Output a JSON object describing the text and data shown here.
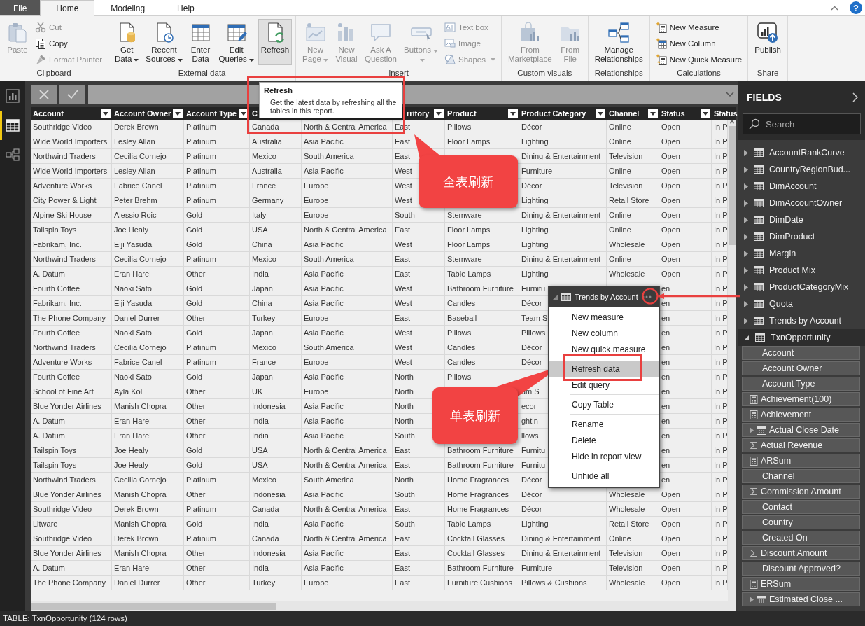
{
  "ribbon": {
    "tabs": [
      {
        "label": "File",
        "kind": "file",
        "selected": false
      },
      {
        "label": "Home",
        "kind": "tab",
        "selected": true
      },
      {
        "label": "Modeling",
        "kind": "tab",
        "selected": false
      },
      {
        "label": "Help",
        "kind": "tab",
        "selected": false
      }
    ],
    "help_button": "?",
    "groups": [
      {
        "title": "Clipboard",
        "items": [
          {
            "kind": "large",
            "lines": [
              "Paste"
            ],
            "disabled": true,
            "dropdown": false,
            "highlighted": false
          },
          {
            "kind": "small",
            "lines": [
              "Cut"
            ],
            "disabled": true,
            "dropdown": false,
            "highlighted": false
          },
          {
            "kind": "small",
            "lines": [
              "Copy"
            ],
            "disabled": false,
            "dropdown": false,
            "highlighted": false
          },
          {
            "kind": "small",
            "lines": [
              "Format Painter"
            ],
            "disabled": true,
            "dropdown": false,
            "highlighted": false
          }
        ]
      },
      {
        "title": "External data",
        "items": [
          {
            "kind": "large",
            "lines": [
              "Get",
              "Data"
            ],
            "disabled": false,
            "dropdown": true,
            "highlighted": false
          },
          {
            "kind": "large",
            "lines": [
              "Recent",
              "Sources"
            ],
            "disabled": false,
            "dropdown": true,
            "highlighted": false
          },
          {
            "kind": "large",
            "lines": [
              "Enter",
              "Data"
            ],
            "disabled": false,
            "dropdown": false,
            "highlighted": false
          },
          {
            "kind": "large",
            "lines": [
              "Edit",
              "Queries"
            ],
            "disabled": false,
            "dropdown": true,
            "highlighted": false
          },
          {
            "kind": "large",
            "lines": [
              "Refresh"
            ],
            "disabled": false,
            "dropdown": false,
            "highlighted": true
          }
        ]
      },
      {
        "title": "Insert",
        "items": [
          {
            "kind": "large",
            "lines": [
              "New",
              "Page"
            ],
            "disabled": true,
            "dropdown": true,
            "highlighted": false
          },
          {
            "kind": "large",
            "lines": [
              "New",
              "Visual"
            ],
            "disabled": true,
            "dropdown": false,
            "highlighted": false
          },
          {
            "kind": "large",
            "lines": [
              "Ask A",
              "Question"
            ],
            "disabled": true,
            "dropdown": false,
            "highlighted": false
          },
          {
            "kind": "large",
            "lines": [
              "Buttons"
            ],
            "disabled": true,
            "dropdown": true,
            "highlighted": false
          },
          {
            "kind": "small",
            "lines": [
              "Text box"
            ],
            "disabled": true,
            "dropdown": false,
            "highlighted": false
          },
          {
            "kind": "small",
            "lines": [
              "Image"
            ],
            "disabled": true,
            "dropdown": false,
            "highlighted": false
          },
          {
            "kind": "small",
            "lines": [
              "Shapes"
            ],
            "disabled": true,
            "dropdown": true,
            "highlighted": false
          }
        ]
      },
      {
        "title": "Custom visuals",
        "items": [
          {
            "kind": "large",
            "lines": [
              "From",
              "Marketplace"
            ],
            "disabled": true,
            "dropdown": false,
            "highlighted": false
          },
          {
            "kind": "large",
            "lines": [
              "From",
              "File"
            ],
            "disabled": true,
            "dropdown": false,
            "highlighted": false
          }
        ]
      },
      {
        "title": "Relationships",
        "items": [
          {
            "kind": "large",
            "lines": [
              "Manage",
              "Relationships"
            ],
            "disabled": false,
            "dropdown": false,
            "highlighted": false
          }
        ]
      },
      {
        "title": "Calculations",
        "items": [
          {
            "kind": "small",
            "lines": [
              "New Measure"
            ],
            "disabled": false,
            "dropdown": false,
            "highlighted": false
          },
          {
            "kind": "small",
            "lines": [
              "New Column"
            ],
            "disabled": false,
            "dropdown": false,
            "highlighted": false
          },
          {
            "kind": "small",
            "lines": [
              "New Quick Measure"
            ],
            "disabled": false,
            "dropdown": false,
            "highlighted": false
          }
        ]
      },
      {
        "title": "Share",
        "items": [
          {
            "kind": "large",
            "lines": [
              "Publish"
            ],
            "disabled": false,
            "dropdown": false,
            "highlighted": false
          }
        ]
      }
    ]
  },
  "nav": [
    {
      "selected": false
    },
    {
      "selected": true
    },
    {
      "selected": false
    }
  ],
  "table": {
    "columns": [
      {
        "label": "Account",
        "filter": true
      },
      {
        "label": "Account Owner",
        "filter": true
      },
      {
        "label": "Account Type",
        "filter": true
      },
      {
        "label": "C"
      },
      {},
      {
        "label": "rritory",
        "filter": true
      },
      {
        "label": "Product",
        "filter": true
      },
      {
        "label": "Product Category",
        "filter": true
      },
      {
        "label": "Channel",
        "filter": true
      },
      {
        "label": "Status",
        "filter": true
      },
      {
        "label": "Status"
      }
    ],
    "rows": [
      [
        "Southridge Video",
        "Derek Brown",
        "Platinum",
        "Canada",
        "North & Central America",
        "East",
        "Pillows",
        "Décor",
        "Online",
        "Open",
        "In P"
      ],
      [
        "Wide World Importers",
        "Lesley Allan",
        "Platinum",
        "Australia",
        "Asia Pacific",
        "East",
        "Floor Lamps",
        "Lighting",
        "Online",
        "Open",
        "In P"
      ],
      [
        "Northwind Traders",
        "Cecilia Cornejo",
        "Platinum",
        "Mexico",
        "South America",
        "East",
        null,
        "Dining & Entertainment",
        "Television",
        "Open",
        "In P"
      ],
      [
        "Wide World Importers",
        "Lesley Allan",
        "Platinum",
        "Australia",
        "Asia Pacific",
        "West",
        null,
        "Furniture",
        "Online",
        "Open",
        "In P"
      ],
      [
        "Adventure Works",
        "Fabrice Canel",
        "Platinum",
        "France",
        "Europe",
        "West",
        null,
        "Décor",
        "Television",
        "Open",
        "In P"
      ],
      [
        "City Power & Light",
        "Peter Brehm",
        "Platinum",
        "Germany",
        "Europe",
        "West",
        null,
        "Lighting",
        "Retail Store",
        "Open",
        "In P"
      ],
      [
        "Alpine Ski House",
        "Alessio Roic",
        "Gold",
        "Italy",
        "Europe",
        "South",
        "Stemware",
        "Dining & Entertainment",
        "Online",
        "Open",
        "In P"
      ],
      [
        "Tailspin Toys",
        "Joe Healy",
        "Gold",
        "USA",
        "North & Central America",
        "East",
        "Floor Lamps",
        "Lighting",
        "Online",
        "Open",
        "In P"
      ],
      [
        "Fabrikam, Inc.",
        "Eiji Yasuda",
        "Gold",
        "China",
        "Asia Pacific",
        "West",
        "Floor Lamps",
        "Lighting",
        "Wholesale",
        "Open",
        "In P"
      ],
      [
        "Northwind Traders",
        "Cecilia Cornejo",
        "Platinum",
        "Mexico",
        "South America",
        "East",
        "Stemware",
        "Dining & Entertainment",
        "Online",
        "Open",
        "In P"
      ],
      [
        "A. Datum",
        "Eran Harel",
        "Other",
        "India",
        "Asia Pacific",
        "East",
        "Table Lamps",
        "Lighting",
        "Wholesale",
        "Open",
        "In P"
      ],
      [
        "Fourth Coffee",
        "Naoki Sato",
        "Gold",
        "Japan",
        "Asia Pacific",
        "West",
        "Bathroom Furniture",
        "Furnitu",
        null,
        "en",
        "In P"
      ],
      [
        "Fabrikam, Inc.",
        "Eiji Yasuda",
        "Gold",
        "China",
        "Asia Pacific",
        "West",
        "Candles",
        "Décor",
        null,
        "en",
        "In P"
      ],
      [
        "The Phone Company",
        "Daniel Durrer",
        "Other",
        "Turkey",
        "Europe",
        "East",
        "Baseball",
        "Team S",
        null,
        "en",
        "In P"
      ],
      [
        "Fourth Coffee",
        "Naoki Sato",
        "Gold",
        "Japan",
        "Asia Pacific",
        "West",
        "Pillows",
        "Pillows",
        null,
        "en",
        "In P"
      ],
      [
        "Northwind Traders",
        "Cecilia Cornejo",
        "Platinum",
        "Mexico",
        "South America",
        "West",
        "Candles",
        "Décor",
        null,
        "en",
        "In P"
      ],
      [
        "Adventure Works",
        "Fabrice Canel",
        "Platinum",
        "France",
        "Europe",
        "West",
        "Candles",
        "Décor",
        null,
        "en",
        "In P"
      ],
      [
        "Fourth Coffee",
        "Naoki Sato",
        "Gold",
        "Japan",
        "Asia Pacific",
        "North",
        "Pillows",
        null,
        null,
        "en",
        "In P"
      ],
      [
        "School of Fine Art",
        "Ayla Kol",
        "Other",
        "UK",
        "Europe",
        "North",
        null,
        "am S",
        null,
        "en",
        "In P"
      ],
      [
        "Blue Yonder Airlines",
        "Manish Chopra",
        "Other",
        "Indonesia",
        "Asia Pacific",
        "North",
        null,
        "ecor",
        null,
        "en",
        "In P"
      ],
      [
        "A. Datum",
        "Eran Harel",
        "Other",
        "India",
        "Asia Pacific",
        "North",
        null,
        "ghtin",
        null,
        "en",
        "In P"
      ],
      [
        "A. Datum",
        "Eran Harel",
        "Other",
        "India",
        "Asia Pacific",
        "South",
        null,
        "llows",
        null,
        "en",
        "In P"
      ],
      [
        "Tailspin Toys",
        "Joe Healy",
        "Gold",
        "USA",
        "North & Central America",
        "East",
        "Bathroom Furniture",
        "Furnitu",
        null,
        "en",
        "In P"
      ],
      [
        "Tailspin Toys",
        "Joe Healy",
        "Gold",
        "USA",
        "North & Central America",
        "East",
        "Bathroom Furniture",
        "Furnitu",
        null,
        "en",
        "In P"
      ],
      [
        "Northwind Traders",
        "Cecilia Cornejo",
        "Platinum",
        "Mexico",
        "South America",
        "North",
        "Home Fragrances",
        "Décor",
        null,
        "en",
        "In P"
      ],
      [
        "Blue Yonder Airlines",
        "Manish Chopra",
        "Other",
        "Indonesia",
        "Asia Pacific",
        "South",
        "Home Fragrances",
        "Décor",
        "Wholesale",
        "Open",
        "In P"
      ],
      [
        "Southridge Video",
        "Derek Brown",
        "Platinum",
        "Canada",
        "North & Central America",
        "East",
        "Home Fragrances",
        "Décor",
        "Wholesale",
        "Open",
        "In P"
      ],
      [
        "Litware",
        "Manish Chopra",
        "Gold",
        "India",
        "Asia Pacific",
        "South",
        "Table Lamps",
        "Lighting",
        "Retail Store",
        "Open",
        "In P"
      ],
      [
        "Southridge Video",
        "Derek Brown",
        "Platinum",
        "Canada",
        "North & Central America",
        "East",
        "Cocktail Glasses",
        "Dining & Entertainment",
        "Online",
        "Open",
        "In P"
      ],
      [
        "Blue Yonder Airlines",
        "Manish Chopra",
        "Other",
        "Indonesia",
        "Asia Pacific",
        "East",
        "Cocktail Glasses",
        "Dining & Entertainment",
        "Television",
        "Open",
        "In P"
      ],
      [
        "A. Datum",
        "Eran Harel",
        "Other",
        "India",
        "Asia Pacific",
        "East",
        "Bathroom Furniture",
        "Furniture",
        "Television",
        "Open",
        "In P"
      ],
      [
        "The Phone Company",
        "Daniel Durrer",
        "Other",
        "Turkey",
        "Europe",
        "East",
        "Furniture Cushions",
        "Pillows & Cushions",
        "Wholesale",
        "Open",
        "In P"
      ]
    ]
  },
  "fields": {
    "title": "FIELDS",
    "search": {
      "placeholder": "Search"
    },
    "tables": [
      {
        "name": "AccountRankCurve",
        "expanded": false
      },
      {
        "name": "CountryRegionBud...",
        "expanded": false
      },
      {
        "name": "DimAccount",
        "expanded": false
      },
      {
        "name": "DimAccountOwner",
        "expanded": false
      },
      {
        "name": "DimDate",
        "expanded": false
      },
      {
        "name": "DimProduct",
        "expanded": false
      },
      {
        "name": "Margin",
        "expanded": false
      },
      {
        "name": "Product Mix",
        "expanded": false
      },
      {
        "name": "ProductCategoryMix",
        "expanded": false
      },
      {
        "name": "Quota",
        "expanded": false
      },
      {
        "name": "Trends by Account",
        "expanded": false
      },
      {
        "name": "TxnOpportunity",
        "expanded": true,
        "children": [
          {
            "name": "Account",
            "kind": "text"
          },
          {
            "name": "Account Owner",
            "kind": "text"
          },
          {
            "name": "Account Type",
            "kind": "text"
          },
          {
            "name": "Achievement(100)",
            "kind": "calc"
          },
          {
            "name": "Achievement",
            "kind": "calc"
          },
          {
            "name": "Actual Close Date",
            "kind": "date"
          },
          {
            "name": "Actual Revenue",
            "kind": "sum"
          },
          {
            "name": "ARSum",
            "kind": "calc"
          },
          {
            "name": "Channel",
            "kind": "text"
          },
          {
            "name": "Commission Amount",
            "kind": "sum"
          },
          {
            "name": "Contact",
            "kind": "text"
          },
          {
            "name": "Country",
            "kind": "text"
          },
          {
            "name": "Created On",
            "kind": "text"
          },
          {
            "name": "Discount Amount",
            "kind": "sum"
          },
          {
            "name": "Discount Approved?",
            "kind": "text"
          },
          {
            "name": "ERSum",
            "kind": "calc"
          },
          {
            "name": "Estimated Close ...",
            "kind": "date"
          }
        ]
      }
    ]
  },
  "status_bar": "TABLE: TxnOpportunity (124 rows)",
  "tooltip": {
    "title": "Refresh",
    "text": "Get the latest data by refreshing all the tables in this report."
  },
  "context_menu": {
    "title": "Trends by Account",
    "groups": [
      [
        {
          "label": "New measure",
          "selected": false
        },
        {
          "label": "New column",
          "selected": false
        },
        {
          "label": "New quick measure",
          "selected": false
        }
      ],
      [
        {
          "label": "Refresh data",
          "selected": true
        },
        {
          "label": "Edit query",
          "selected": false
        }
      ],
      [
        {
          "label": "Copy Table",
          "selected": false
        }
      ],
      [
        {
          "label": "Rename",
          "selected": false
        },
        {
          "label": "Delete",
          "selected": false
        },
        {
          "label": "Hide in report view",
          "selected": false
        }
      ],
      [
        {
          "label": "Unhide all",
          "selected": false
        }
      ]
    ]
  },
  "callouts": [
    {
      "text": "全表刷新"
    },
    {
      "text": "单表刷新"
    }
  ]
}
